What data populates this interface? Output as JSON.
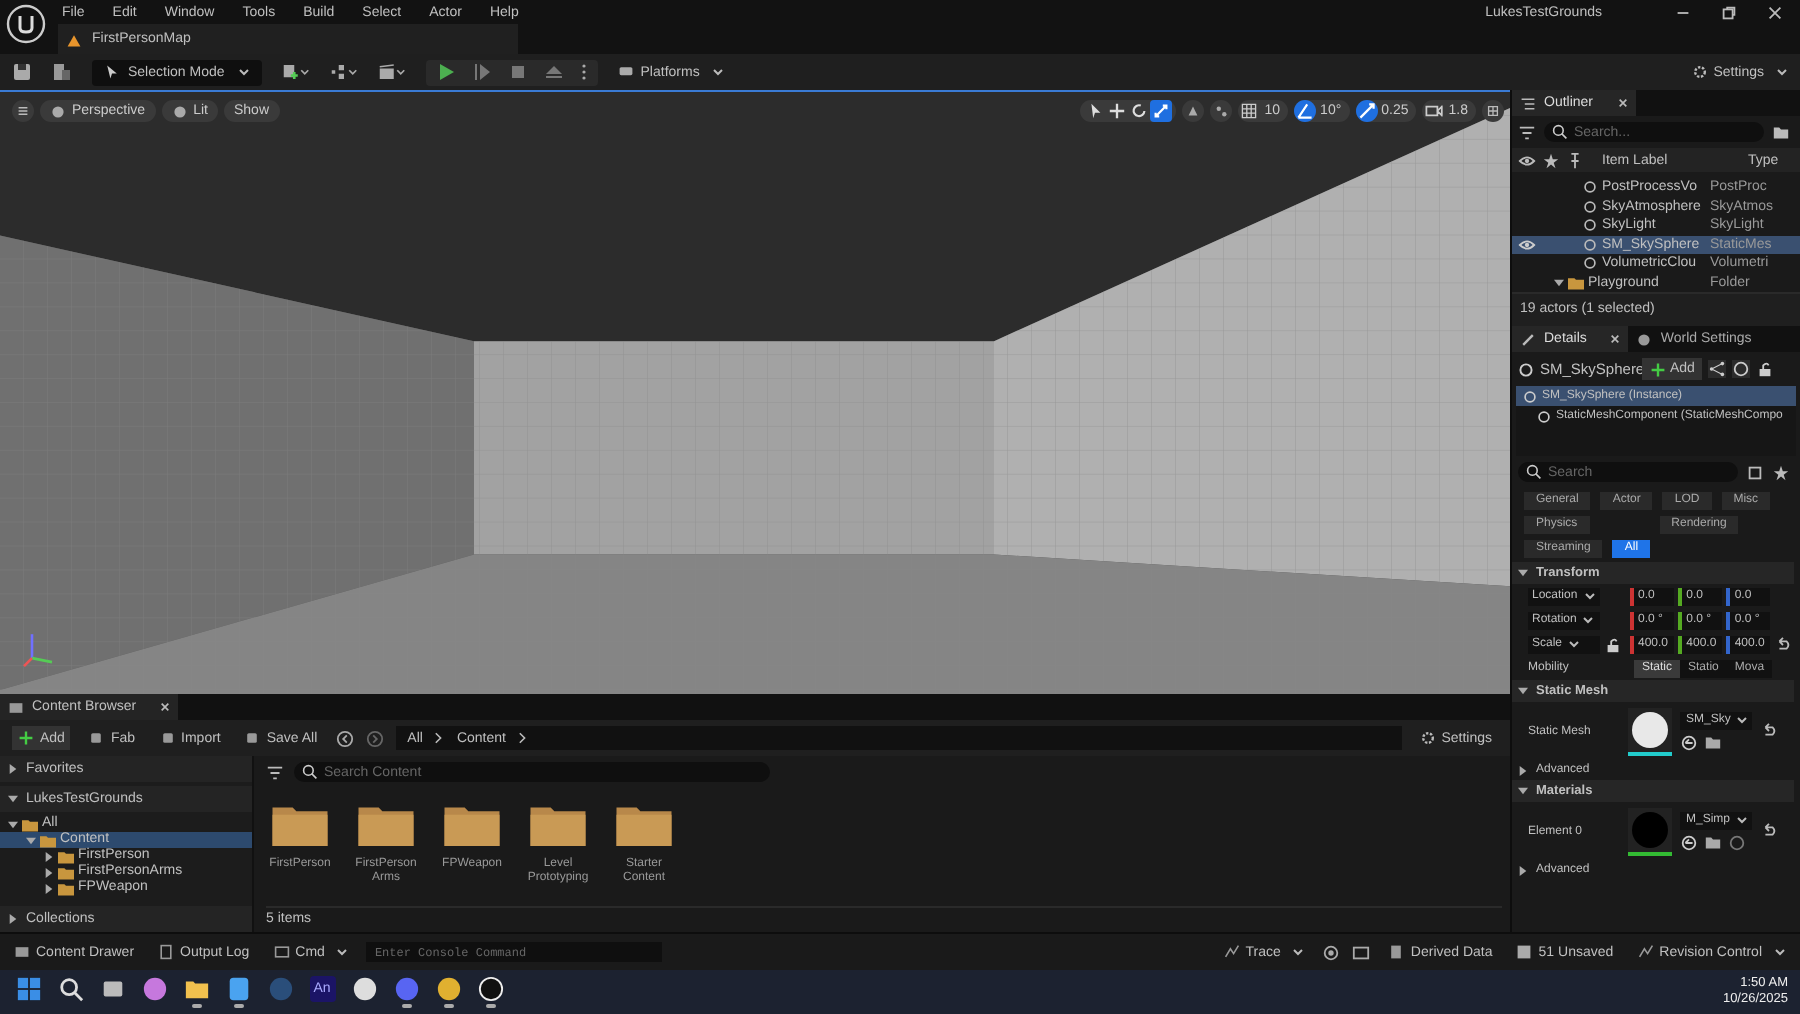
{
  "window": {
    "menu": [
      "File",
      "Edit",
      "Window",
      "Tools",
      "Build",
      "Select",
      "Actor",
      "Help"
    ],
    "project": "LukesTestGrounds",
    "map_tab": "FirstPersonMap"
  },
  "toolbar": {
    "mode": "Selection Mode",
    "platforms": "Platforms",
    "settings": "Settings"
  },
  "viewport": {
    "view_buttons": [
      "Perspective",
      "Lit",
      "Show"
    ],
    "transform_tools": [
      {
        "kind": "select",
        "selected": false
      },
      {
        "kind": "move",
        "selected": false
      },
      {
        "kind": "rotate",
        "selected": false
      },
      {
        "kind": "scale",
        "selected": true
      }
    ],
    "snaps": [
      {
        "kind": "grid",
        "label": "10",
        "on": false
      },
      {
        "kind": "angle",
        "label": "10°",
        "on": true
      },
      {
        "kind": "scale",
        "label": "0.25",
        "on": true
      },
      {
        "kind": "camera",
        "label": "1.8",
        "on": false
      }
    ]
  },
  "outliner": {
    "title": "Outliner",
    "search": {
      "placeholder": "Search..."
    },
    "columns": [
      "Item Label",
      "Type"
    ],
    "rows": [
      {
        "kind": "actor",
        "name": "PostProcessVo",
        "type": "PostProc",
        "selected": false
      },
      {
        "kind": "actor",
        "name": "SkyAtmosphere",
        "type": "SkyAtmos",
        "selected": false
      },
      {
        "kind": "actor",
        "name": "SkyLight",
        "type": "SkyLight",
        "selected": false
      },
      {
        "kind": "actor",
        "name": "SM_SkySphere",
        "type": "StaticMes",
        "selected": true
      },
      {
        "kind": "actor",
        "name": "VolumetricClou",
        "type": "Volumetri",
        "selected": false
      },
      {
        "kind": "folder",
        "name": "Playground",
        "type": "Folder",
        "selected": false,
        "expanded": true
      }
    ],
    "status": "19 actors (1 selected)"
  },
  "details": {
    "tabs": [
      {
        "label": "Details",
        "selected": true
      },
      {
        "label": "World Settings",
        "selected": false
      }
    ],
    "actor": "SM_SkySphere",
    "add": "Add",
    "components": [
      {
        "label": "SM_SkySphere (Instance)",
        "selected": true
      },
      {
        "label": "StaticMeshComponent (StaticMeshCompo",
        "selected": false
      }
    ],
    "search": {
      "placeholder": "Search"
    },
    "filters": [
      {
        "label": "General",
        "selected": false
      },
      {
        "label": "Actor",
        "selected": false
      },
      {
        "label": "LOD",
        "selected": false
      },
      {
        "label": "Misc",
        "selected": false
      },
      {
        "label": "Physics",
        "selected": false
      },
      {
        "label": "Rendering",
        "selected": false
      },
      {
        "label": "Streaming",
        "selected": false
      },
      {
        "label": "All",
        "selected": true
      }
    ],
    "transform": {
      "title": "Transform",
      "rows": [
        {
          "label": "Location",
          "values": [
            "0.0",
            "0.0",
            "0.0"
          ],
          "reset": false
        },
        {
          "label": "Rotation",
          "values": [
            "0.0 °",
            "0.0 °",
            "0.0 °"
          ],
          "reset": false
        },
        {
          "label": "Scale",
          "values": [
            "400.0",
            "400.0",
            "400.0"
          ],
          "reset": true,
          "locked": false
        }
      ],
      "mobility": {
        "label": "Mobility",
        "options": [
          {
            "label": "Static",
            "selected": true
          },
          {
            "label": "Statio",
            "selected": false
          },
          {
            "label": "Mova",
            "selected": false
          }
        ]
      }
    },
    "sections": [
      {
        "title": "Static Mesh",
        "kind": "mesh",
        "label": "Static Mesh",
        "asset": "SM_Sky",
        "advanced": "Advanced"
      },
      {
        "title": "Materials",
        "kind": "material",
        "label": "Element 0",
        "asset": "M_Simp",
        "advanced": "Advanced"
      }
    ]
  },
  "content_browser": {
    "title": "Content Browser",
    "actions": [
      "Add",
      "Fab",
      "Import",
      "Save All"
    ],
    "path": [
      "All",
      "Content"
    ],
    "settings": "Settings",
    "favorites": "Favorites",
    "project": "LukesTestGrounds",
    "tree": [
      {
        "label": "All",
        "expanded": true,
        "selected": false,
        "children": [
          {
            "label": "Content",
            "expanded": true,
            "selected": true,
            "children": [
              {
                "label": "FirstPerson",
                "expanded": false,
                "selected": false
              },
              {
                "label": "FirstPersonArms",
                "expanded": false,
                "selected": false
              },
              {
                "label": "FPWeapon",
                "expanded": false,
                "selected": false
              }
            ]
          }
        ]
      }
    ],
    "collections": "Collections",
    "search": {
      "placeholder": "Search Content"
    },
    "folders": [
      "FirstPerson",
      "FirstPerson Arms",
      "FPWeapon",
      "Level Prototyping",
      "Starter Content"
    ],
    "count": "5 items"
  },
  "status_bar": {
    "drawer": "Content Drawer",
    "output": "Output Log",
    "cmd": "Cmd",
    "console": {
      "placeholder": "Enter Console Command"
    },
    "trace": "Trace",
    "ddc": "Derived Data",
    "unsaved": "51 Unsaved",
    "revision": "Revision Control"
  },
  "taskbar": {
    "apps": [
      {
        "kind": "start",
        "running": false
      },
      {
        "kind": "search",
        "running": false
      },
      {
        "kind": "taskview",
        "running": false
      },
      {
        "kind": "copilot",
        "running": false
      },
      {
        "kind": "explorer",
        "running": true
      },
      {
        "kind": "notepad",
        "running": true
      },
      {
        "kind": "steam",
        "running": false
      },
      {
        "kind": "animate",
        "label": "An",
        "running": false
      },
      {
        "kind": "chatgpt",
        "running": false
      },
      {
        "kind": "discord",
        "running": true
      },
      {
        "kind": "chrome",
        "running": true
      },
      {
        "kind": "unreal",
        "running": true
      }
    ],
    "time": "1:50 AM",
    "date": "10/26/2025"
  }
}
